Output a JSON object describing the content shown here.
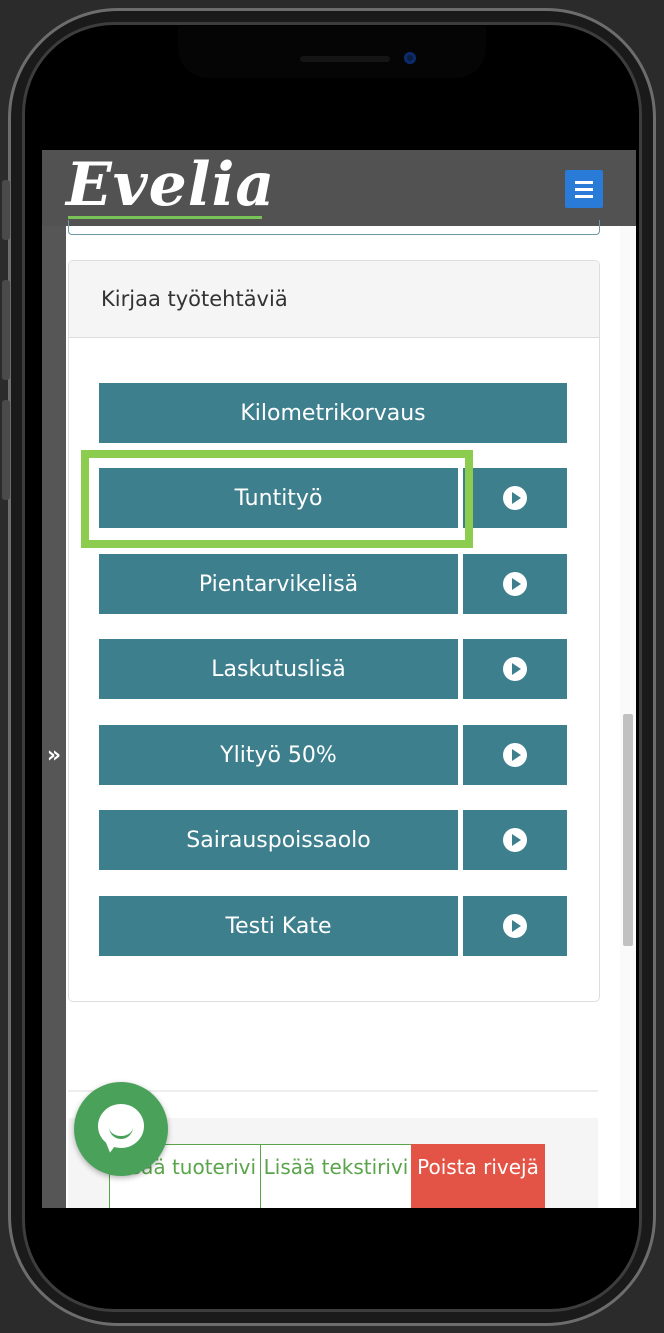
{
  "brand": {
    "logo_text": "Evelia",
    "accent_green": "#78c257",
    "button_teal": "#3e7f8e",
    "menu_blue": "#2a7bd8",
    "delete_red": "#e35446"
  },
  "header": {
    "menu_icon": "hamburger-icon"
  },
  "sidebar": {
    "expand_label": "»",
    "expand_icon": "double-chevron-right-icon"
  },
  "card": {
    "title": "Kirjaa työtehtäviä",
    "tasks": [
      {
        "label": "Kilometrikorvaus",
        "has_play": false
      },
      {
        "label": "Tuntityö",
        "has_play": true
      },
      {
        "label": "Pientarvikelisä",
        "has_play": true
      },
      {
        "label": "Laskutuslisä",
        "has_play": true
      },
      {
        "label": "Ylityö 50%",
        "has_play": true
      },
      {
        "label": "Sairauspoissaolo",
        "has_play": true
      },
      {
        "label": "Testi Kate",
        "has_play": true
      }
    ],
    "highlighted_task": "Tuntityö"
  },
  "bottom_actions": {
    "add_product_row": "Lisää tuoterivi",
    "add_text_row": "Lisää tekstirivi",
    "delete_rows": "Poista rivejä"
  },
  "chat": {
    "icon": "chat-bubble-icon"
  }
}
